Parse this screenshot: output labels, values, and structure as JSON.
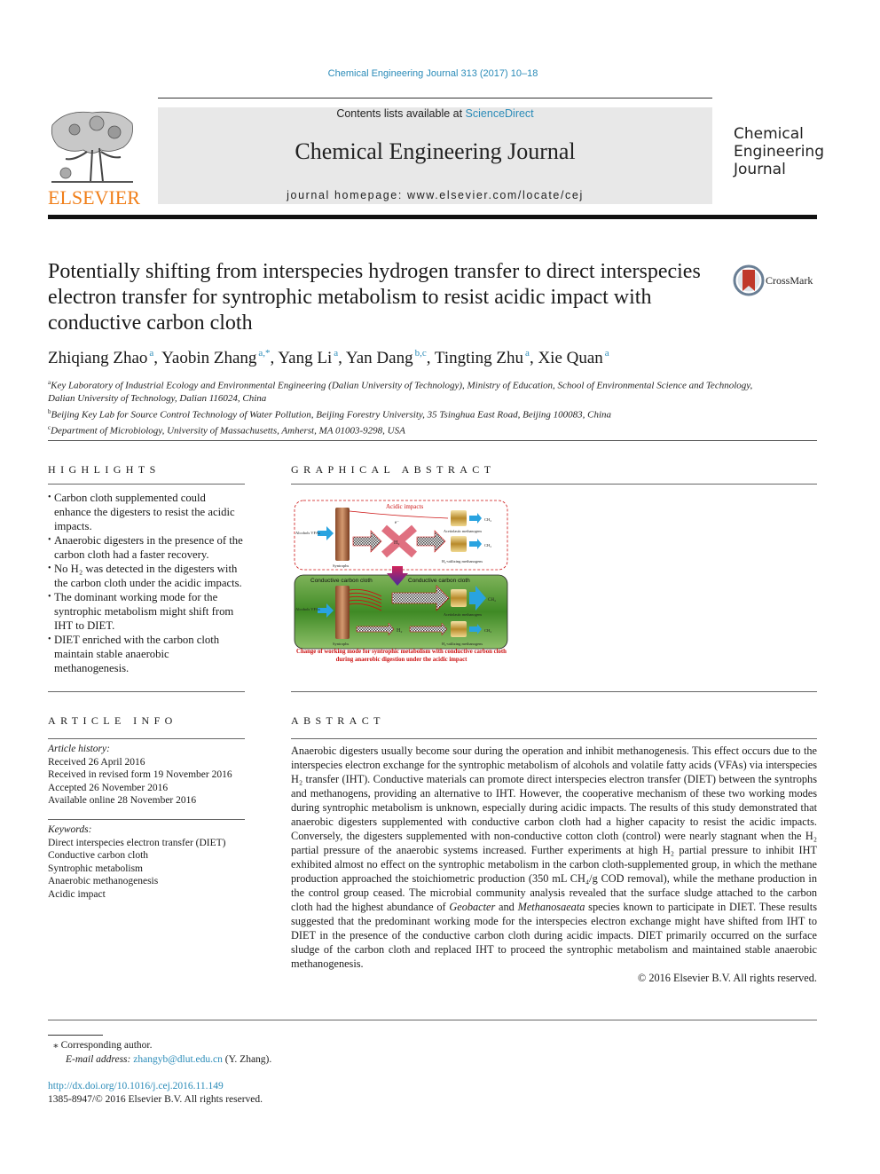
{
  "header": {
    "citation": "Chemical Engineering Journal 313 (2017) 10–18",
    "contents_prefix": "Contents lists available at ",
    "contents_link": "ScienceDirect",
    "journal_title": "Chemical Engineering Journal",
    "homepage_label": "journal homepage: ",
    "homepage_url": "www.elsevier.com/locate/cej",
    "publisher": "ELSEVIER",
    "journal_logo_lines": [
      "Chemical",
      "Engineering",
      "Journal"
    ]
  },
  "article": {
    "title": "Potentially shifting from interspecies hydrogen transfer to direct interspecies electron transfer for syntrophic metabolism to resist acidic impact with conductive carbon cloth",
    "crossmark_label": "CrossMark",
    "authors": [
      {
        "name": "Zhiqiang Zhao",
        "aff": "a"
      },
      {
        "name": "Yaobin Zhang",
        "aff": "a,*"
      },
      {
        "name": "Yang Li",
        "aff": "a"
      },
      {
        "name": "Yan Dang",
        "aff": "b,c"
      },
      {
        "name": "Tingting Zhu",
        "aff": "a"
      },
      {
        "name": "Xie Quan",
        "aff": "a"
      }
    ],
    "affiliations": [
      {
        "mark": "a",
        "text": "Key Laboratory of Industrial Ecology and Environmental Engineering (Dalian University of Technology), Ministry of Education, School of Environmental Science and Technology, Dalian University of Technology, Dalian 116024, China"
      },
      {
        "mark": "b",
        "text": "Beijing Key Lab for Source Control Technology of Water Pollution, Beijing Forestry University, 35 Tsinghua East Road, Beijing 100083, China"
      },
      {
        "mark": "c",
        "text": "Department of Microbiology, University of Massachusetts, Amherst, MA 01003-9298, USA"
      }
    ]
  },
  "highlights": {
    "heading": "HIGHLIGHTS",
    "items": [
      "Carbon cloth supplemented could enhance the digesters to resist the acidic impacts.",
      "Anaerobic digesters in the presence of the carbon cloth had a faster recovery.",
      "No H₂ was detected in the digesters with the carbon cloth under the acidic impacts.",
      "The dominant working mode for the syntrophic metabolism might shift from IHT to DIET.",
      "DIET enriched with the carbon cloth maintain stable anaerobic methanogenesis."
    ]
  },
  "graphical_abstract": {
    "heading": "GRAPHICAL ABSTRACT",
    "top_panel_title": "Acidic impacts",
    "bottom_panel_title_left": "Conductive carbon cloth",
    "bottom_panel_title_right": "Conductive carbon cloth",
    "input_label": "Alcohols VFAs",
    "syntrophs_label": "Syntrophs",
    "electron_label": "e⁻",
    "h2_label": "H₂",
    "acetoclastic_label": "Acetiolastic methanogens",
    "h2_utilizing_label": "H₂-utilizing methanogens",
    "ch4_label": "CH₄",
    "caption": "Change of working mode for syntrophic metabolism with conductive carbon cloth during anaerobic digestion under the acidic impact"
  },
  "article_info": {
    "heading": "ARTICLE INFO",
    "history_label": "Article history:",
    "history": [
      "Received 26 April 2016",
      "Received in revised form 19 November 2016",
      "Accepted 26 November 2016",
      "Available online 28 November 2016"
    ],
    "keywords_label": "Keywords:",
    "keywords": [
      "Direct interspecies electron transfer (DIET)",
      "Conductive carbon cloth",
      "Syntrophic metabolism",
      "Anaerobic methanogenesis",
      "Acidic impact"
    ]
  },
  "abstract": {
    "heading": "ABSTRACT",
    "p1": "Anaerobic digesters usually become sour during the operation and inhibit methanogenesis. This effect occurs due to the interspecies electron exchange for the syntrophic metabolism of alcohols and volatile fatty acids (VFAs) via interspecies H₂ transfer (IHT). Conductive materials can promote direct interspecies electron transfer (DIET) between the syntrophs and methanogens, providing an alternative to IHT. However, the cooperative mechanism of these two working modes during syntrophic metabolism is unknown, especially during acidic impacts. The results of this study demonstrated that anaerobic digesters supplemented with conductive carbon cloth had a higher capacity to resist the acidic impacts. Conversely, the digesters supplemented with non-conductive cotton cloth (control) were nearly stagnant when the H₂ partial pressure of the anaerobic systems increased. Further experiments at high H₂ partial pressure to inhibit IHT exhibited almost no effect on the syntrophic metabolism in the carbon cloth-supplemented group, in which the methane production approached the stoichiometric production (350 mL CH₄/g COD removal), while the methane production in the control group ceased. The microbial community analysis revealed that the surface sludge attached to the carbon cloth had the highest abundance of ",
    "italic1": "Geobacter",
    "mid": " and ",
    "italic2": "Methanosaeata",
    "p2": " species known to participate in DIET. These results suggested that the predominant working mode for the interspecies electron exchange might have shifted from IHT to DIET in the presence of the conductive carbon cloth during acidic impacts. DIET primarily occurred on the surface sludge of the carbon cloth and replaced IHT to proceed the syntrophic metabolism and maintained stable anaerobic methanogenesis.",
    "copyright": "© 2016 Elsevier B.V. All rights reserved."
  },
  "footer": {
    "corresponding_mark": "⁎",
    "corresponding_text": "Corresponding author.",
    "email_label": "E-mail address: ",
    "email": "zhangyb@dlut.edu.cn",
    "email_owner": " (Y. Zhang).",
    "doi": "http://dx.doi.org/10.1016/j.cej.2016.11.149",
    "issn_copyright": "1385-8947/© 2016 Elsevier B.V. All rights reserved."
  },
  "colors": {
    "link": "#2a8bb8",
    "elsevier_orange": "#f07f1a",
    "masthead_gray": "#e8e8e8",
    "ga_red": "#cc1111",
    "ga_green": "#4a8a2a"
  }
}
